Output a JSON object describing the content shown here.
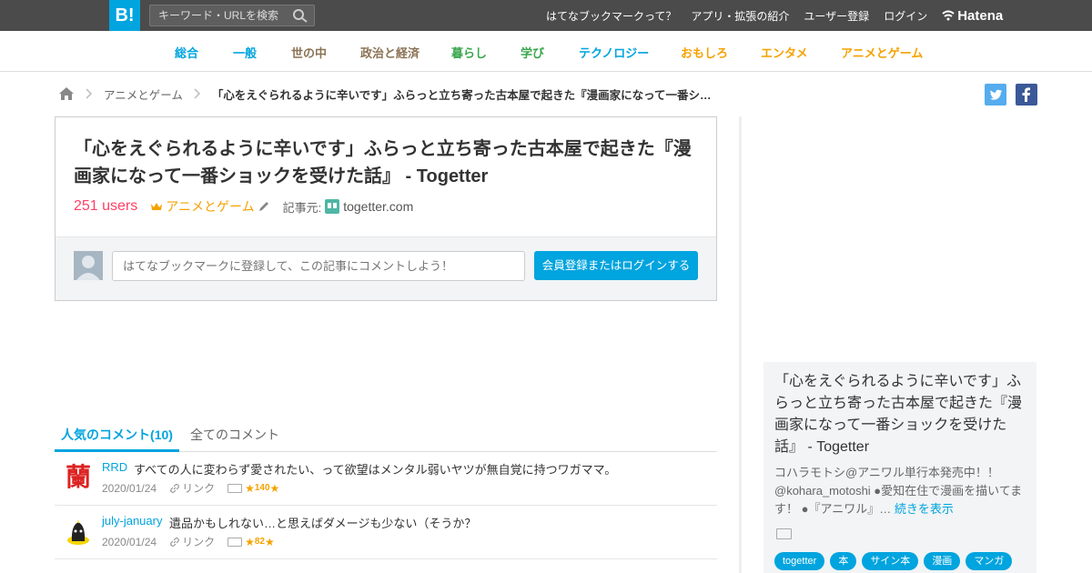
{
  "header": {
    "logo": "B!",
    "search_placeholder": "キーワード・URLを検索",
    "links": [
      "はてなブックマークって？",
      "アプリ・拡張の紹介",
      "ユーザー登録",
      "ログイン"
    ],
    "brand": "Hatena"
  },
  "categories": [
    {
      "label": "総合",
      "color": "#00a4de"
    },
    {
      "label": "一般",
      "color": "#00a4de"
    },
    {
      "label": "世の中",
      "color": "#8b7355"
    },
    {
      "label": "政治と経済",
      "color": "#8b7355"
    },
    {
      "label": "暮らし",
      "color": "#3aa64c"
    },
    {
      "label": "学び",
      "color": "#3aa64c"
    },
    {
      "label": "テクノロジー",
      "color": "#00a4de"
    },
    {
      "label": "おもしろ",
      "color": "#f5a200"
    },
    {
      "label": "エンタメ",
      "color": "#f5a200"
    },
    {
      "label": "アニメとゲーム",
      "color": "#f5a200"
    }
  ],
  "breadcrumb": {
    "category": "アニメとゲーム",
    "current": "「心をえぐられるように辛いです」ふらっと立ち寄った古本屋で起きた『漫画家になって一番シ…"
  },
  "entry": {
    "title": "「心をえぐられるように辛いです」ふらっと立ち寄った古本屋で起きた『漫画家になって一番ショックを受けた話』 - Togetter",
    "users": "251 users",
    "category": "アニメとゲーム",
    "source_label": "記事元:",
    "source_domain": "togetter.com",
    "comment_placeholder": "はてなブックマークに登録して、この記事にコメントしよう！",
    "login_button": "会員登録またはログインする"
  },
  "tabs": {
    "popular": "人気のコメント(10)",
    "all": "全てのコメント"
  },
  "comments": [
    {
      "user": "RRD",
      "text": "すべての人に変わらず愛されたい、って欲望はメンタル弱いヤツが無自覚に持つワガママ。",
      "date": "2020/01/24",
      "link": "リンク",
      "stars": "140",
      "avatar_glyph": "蘭"
    },
    {
      "user": "july-january",
      "text": "遺品かもしれない…と思えばダメージも少ない（そうか？",
      "date": "2020/01/24",
      "link": "リンク",
      "stars": "82",
      "avatar_glyph": ""
    }
  ],
  "sidebar": {
    "title": "「心をえぐられるように辛いです」ふらっと立ち寄った古本屋で起きた『漫画家になって一番ショックを受けた話』 - Togetter",
    "description": "コハラモトシ@アニワル単行本発売中！！ @kohara_motoshi ●愛知在住で漫画を描いてます！ ●『アニワル』…",
    "more": "続きを表示",
    "tags": [
      "togetter",
      "本",
      "サイン本",
      "漫画",
      "マンガ"
    ]
  },
  "colors": {
    "accent": "#00a4de",
    "users": "#ff4166",
    "star": "#f5a200",
    "topbar": "#4b4b4b"
  }
}
